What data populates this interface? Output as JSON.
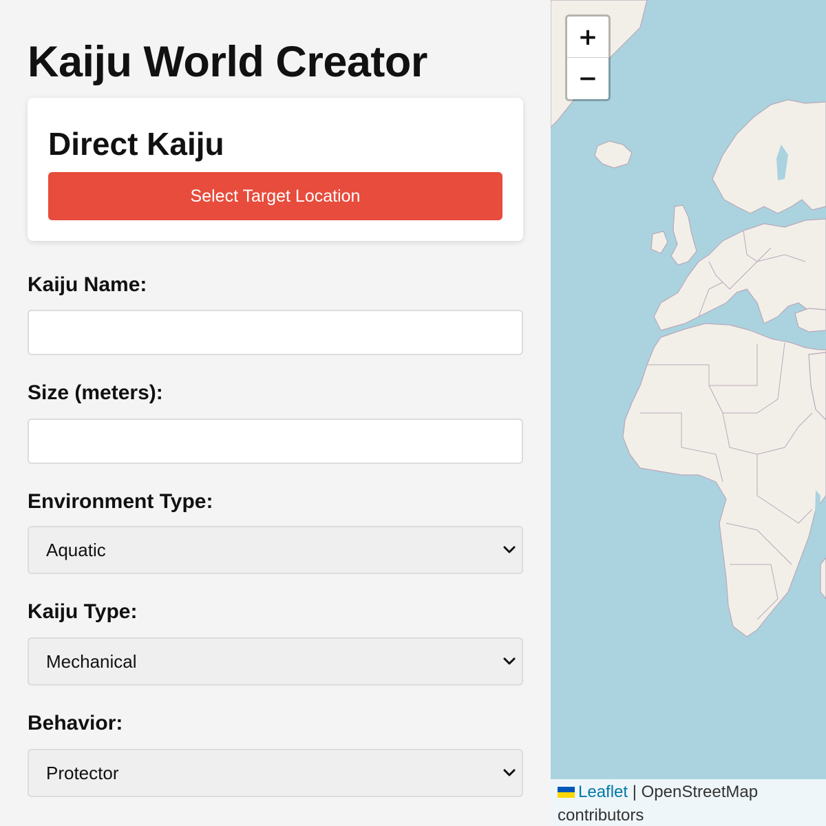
{
  "page": {
    "title": "Kaiju World Creator"
  },
  "direct_card": {
    "title": "Direct Kaiju",
    "select_target_label": "Select Target Location"
  },
  "form": {
    "name_label": "Kaiju Name:",
    "name_value": "",
    "size_label": "Size (meters):",
    "size_value": "",
    "environment_label": "Environment Type:",
    "environment_value": "Aquatic",
    "type_label": "Kaiju Type:",
    "type_value": "Mechanical",
    "behavior_label": "Behavior:",
    "behavior_value": "Protector"
  },
  "map": {
    "zoom_in_label": "+",
    "zoom_out_label": "−",
    "attribution_link": "Leaflet",
    "attribution_sep": " | ",
    "attribution_text": "OpenStreetMap contributors",
    "colors": {
      "water": "#aad3df",
      "land": "#f2efe9",
      "border": "#b9a8b9"
    }
  },
  "colors": {
    "accent_button": "#e74c3c",
    "panel_bg": "#f4f4f4"
  }
}
